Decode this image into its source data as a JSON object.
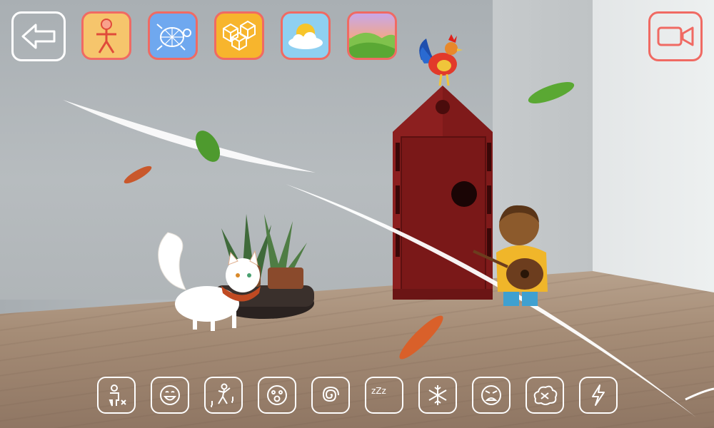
{
  "app": {
    "top_bar": {
      "back_button": {
        "icon": "back-arrow-icon"
      },
      "categories": [
        {
          "id": "characters",
          "icon": "stick-figure-icon",
          "bg": "#f6c56c"
        },
        {
          "id": "animals",
          "icon": "turtle-icon",
          "bg": "#6fa8ef"
        },
        {
          "id": "objects",
          "icon": "cubes-icon",
          "bg": "#f7b52d"
        },
        {
          "id": "weather",
          "icon": "sun-cloud-icon",
          "bg": "#8fd0f1"
        },
        {
          "id": "landscapes",
          "icon": "hills-icon",
          "bg": "#c9a7e8"
        }
      ],
      "record_button": {
        "icon": "video-camera-icon",
        "color": "#f06a63"
      }
    },
    "actions": [
      {
        "id": "remove-character",
        "icon": "person-remove-icon"
      },
      {
        "id": "happy",
        "icon": "happy-face-icon"
      },
      {
        "id": "dance",
        "icon": "dancing-figure-icon"
      },
      {
        "id": "surprised",
        "icon": "surprised-face-icon"
      },
      {
        "id": "dizzy",
        "icon": "spiral-icon"
      },
      {
        "id": "sleep",
        "icon": "zzz-icon",
        "text": "zZz"
      },
      {
        "id": "freeze",
        "icon": "snowflake-icon"
      },
      {
        "id": "angry",
        "icon": "angry-face-icon"
      },
      {
        "id": "fight",
        "icon": "fight-cloud-icon"
      },
      {
        "id": "zap",
        "icon": "lightning-icon"
      }
    ],
    "scene": {
      "stickers": [
        "rooster",
        "white-cat",
        "boy-with-lute",
        "red-wooden-house",
        "potted-succulents",
        "wind-streaks",
        "leaves"
      ]
    }
  }
}
